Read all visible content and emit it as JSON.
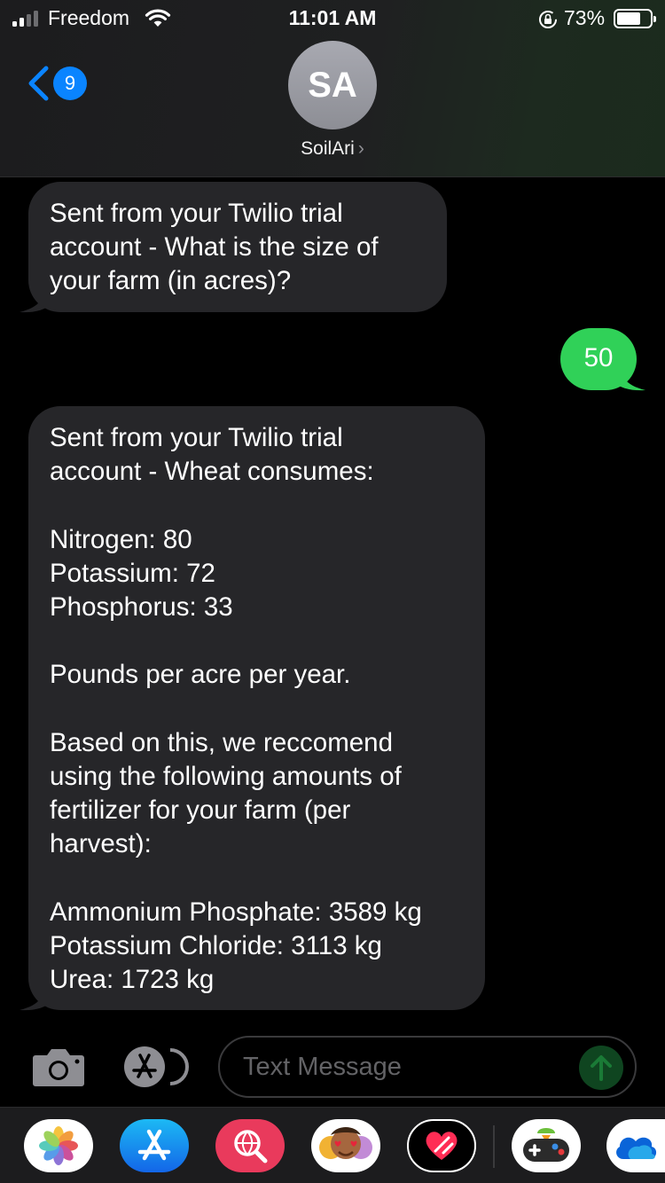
{
  "status_bar": {
    "carrier": "Freedom",
    "time": "11:01 AM",
    "battery_percent": "73%",
    "battery_level": 0.73,
    "signal_bars_filled": 2,
    "signal_bars_total": 4
  },
  "header": {
    "back_badge_count": "9",
    "avatar_initials": "SA",
    "contact_name": "SoilAri",
    "contact_chevron": "›"
  },
  "messages": [
    {
      "direction": "incoming",
      "text": "Sent from your Twilio trial\naccount - What is the size of\nyour farm (in acres)?"
    },
    {
      "direction": "outgoing",
      "text": "50"
    },
    {
      "direction": "incoming",
      "text": "Sent from your Twilio trial\naccount - Wheat consumes:\n\nNitrogen: 80\nPotassium: 72\nPhosphorus: 33\n\nPounds per acre per year.\n\nBased on this, we reccomend\nusing the following amounts of\nfertilizer for your farm (per\nharvest):\n\nAmmonium Phosphate: 3589 kg\nPotassium Chloride: 3113 kg\nUrea: 1723 kg"
    }
  ],
  "input_bar": {
    "placeholder": "Text Message",
    "camera_icon": "camera-icon",
    "appstore_icon": "app-store-icon",
    "send_icon": "arrow-up-icon"
  },
  "app_drawer": {
    "apps": [
      "photos",
      "app-store",
      "web-search",
      "memoji-stickers",
      "digital-touch",
      "game-pigeon",
      "onedrive"
    ]
  },
  "colors": {
    "incoming_bubble": "#262629",
    "outgoing_bubble": "#30d158",
    "accent_blue": "#0a84ff",
    "background": "#000000"
  }
}
